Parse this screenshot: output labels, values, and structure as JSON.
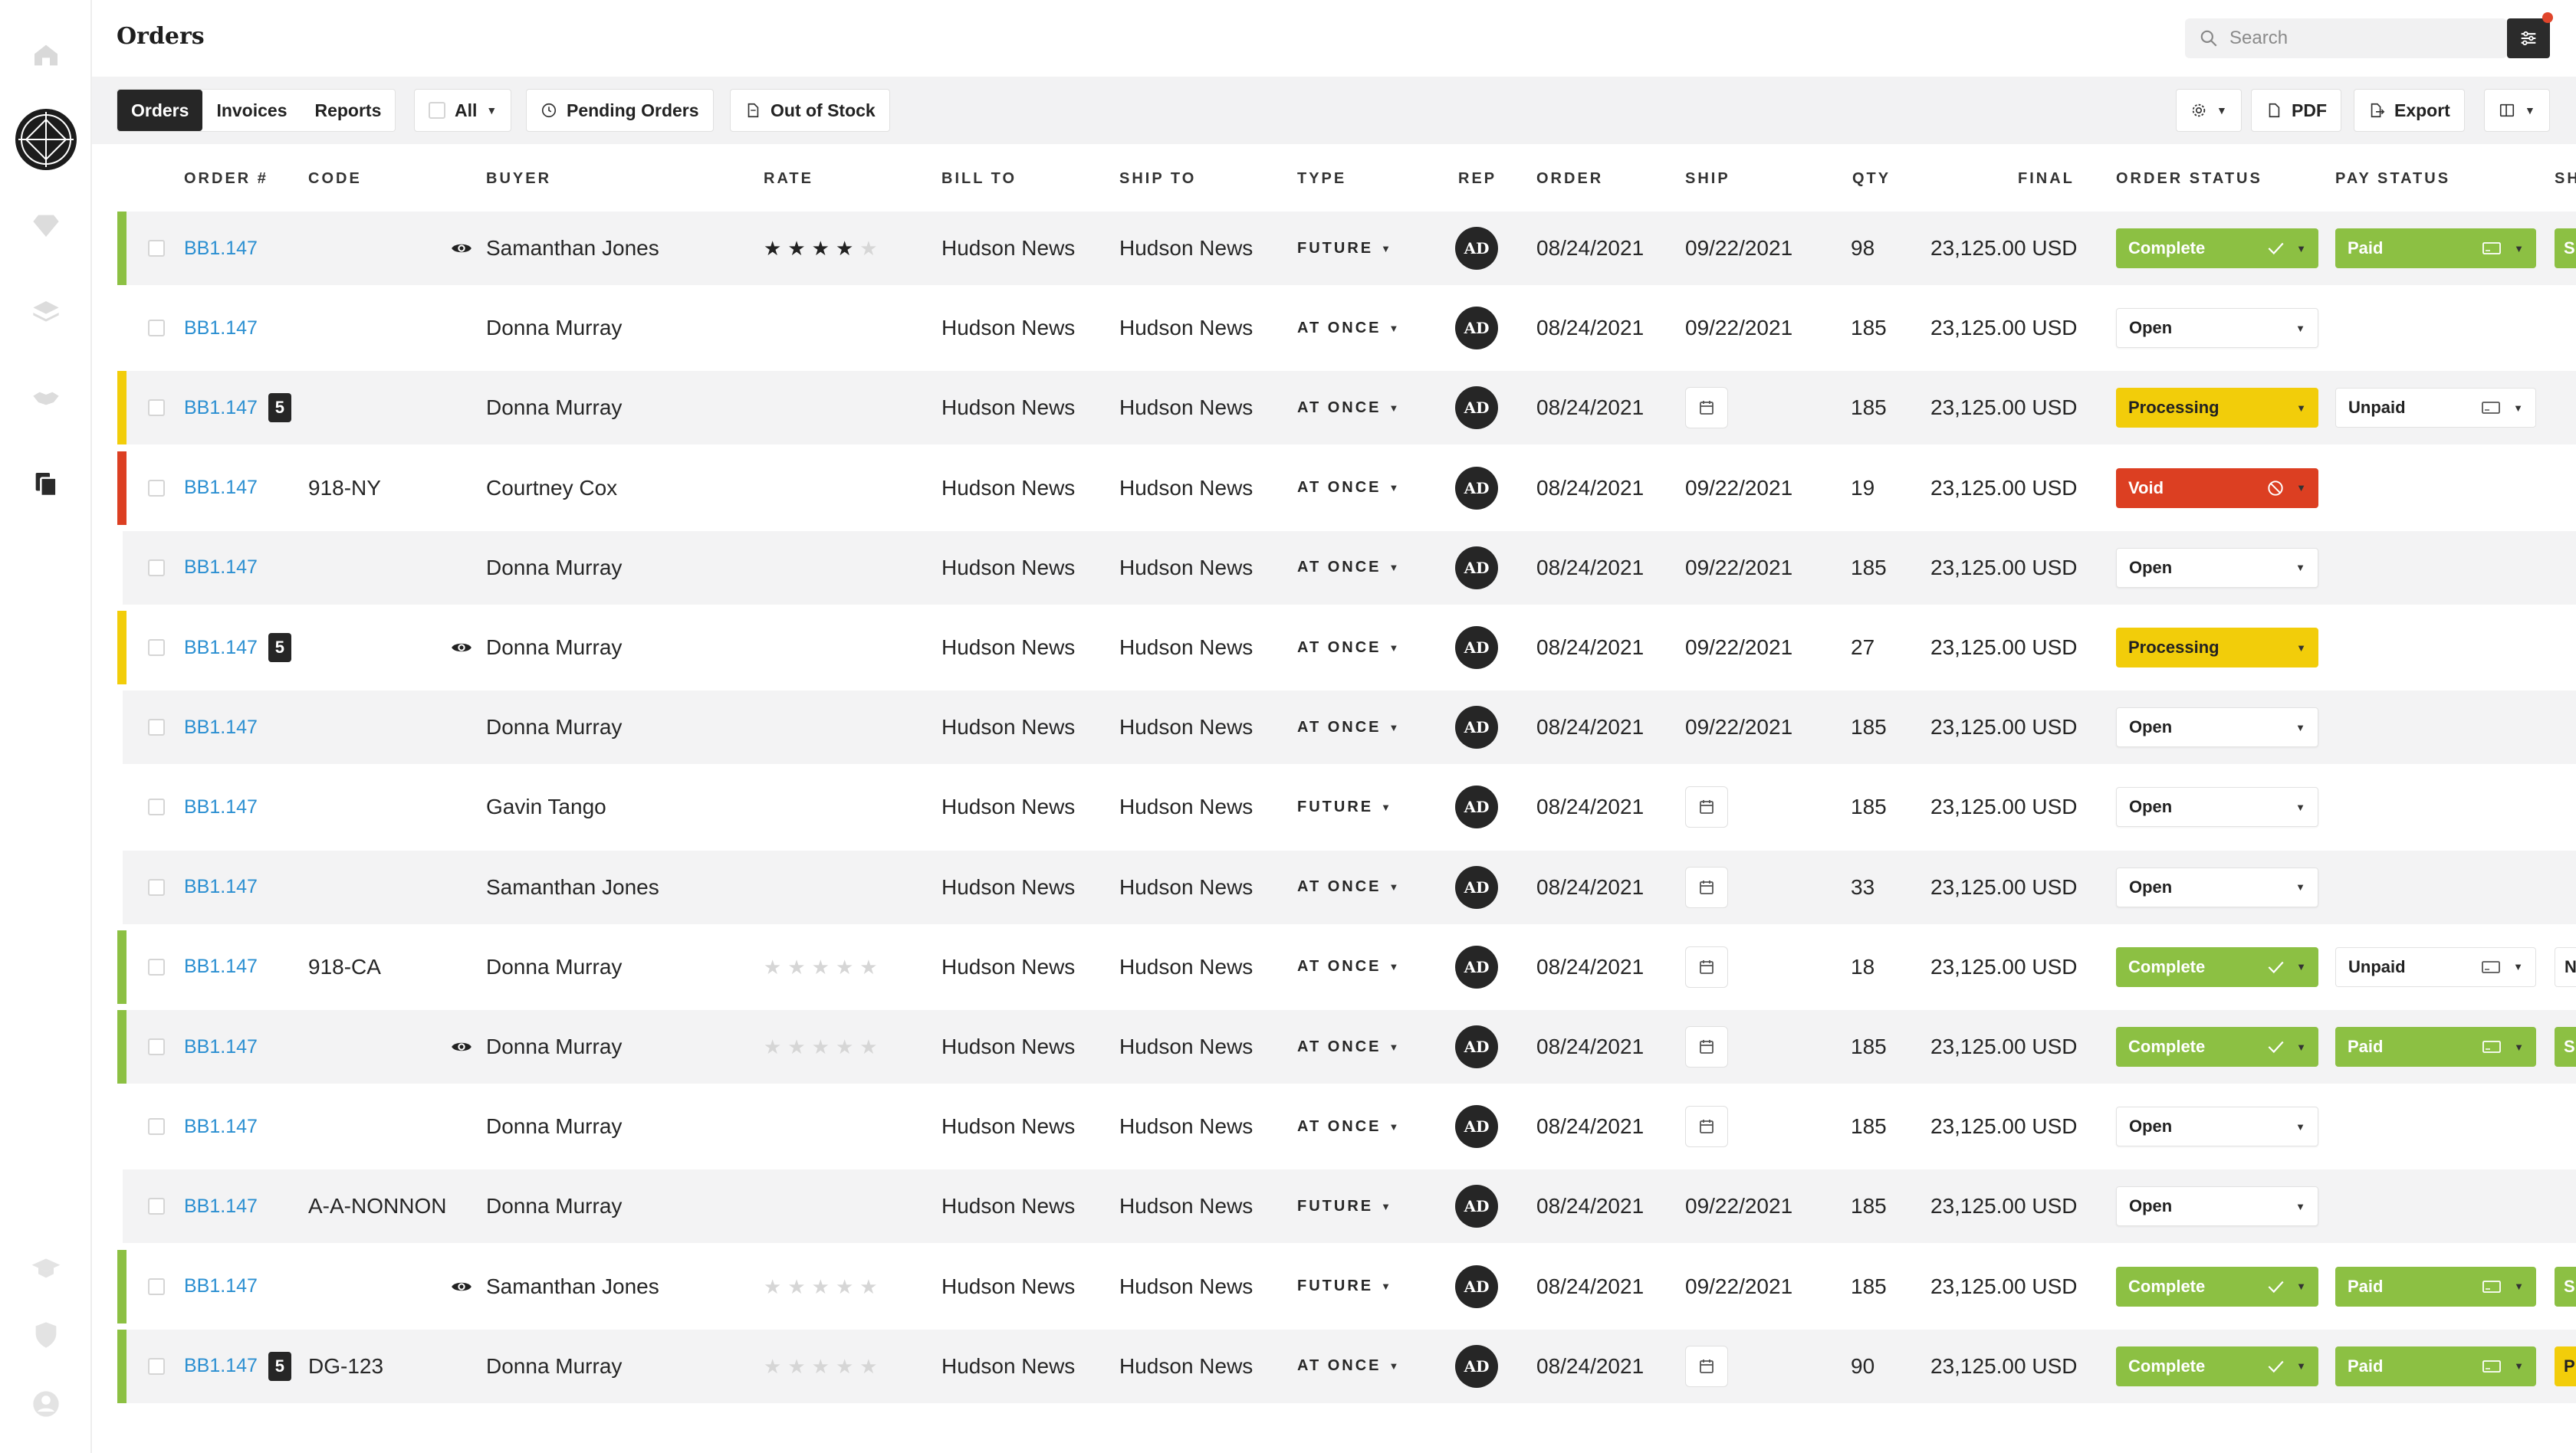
{
  "header": {
    "title": "Orders",
    "search_placeholder": "Search"
  },
  "toolbar": {
    "tabs": [
      "Orders",
      "Invoices",
      "Reports"
    ],
    "filter_all": "All",
    "pending": "Pending Orders",
    "out_of_stock": "Out of Stock",
    "pdf": "PDF",
    "export": "Export"
  },
  "columns": [
    "ORDER #",
    "CODE",
    "BUYER",
    "RATE",
    "BILL TO",
    "SHIP TO",
    "TYPE",
    "REP",
    "ORDER",
    "SHIP",
    "QTY",
    "FINAL",
    "ORDER STATUS",
    "PAY STATUS",
    "SH"
  ],
  "colors": {
    "complete": "#8cc043",
    "processing": "#f2cd0a",
    "void": "#dc3f22",
    "link": "#2b8fd1"
  },
  "rows": [
    {
      "order": "BB1.147",
      "badge": "",
      "code": "",
      "eye": true,
      "buyer": "Samanthan Jones",
      "rating": 4,
      "bill_to": "Hudson News",
      "ship_to": "Hudson News",
      "type": "FUTURE",
      "rep": "AD",
      "order_date": "08/24/2021",
      "ship": "09/22/2021",
      "qty": "98",
      "final": "23,125.00 USD",
      "order_status": "Complete",
      "pay_status": "Paid",
      "sh": "S",
      "bar": "complete"
    },
    {
      "order": "BB1.147",
      "badge": "",
      "code": "",
      "eye": false,
      "buyer": "Donna Murray",
      "rating": null,
      "bill_to": "Hudson News",
      "ship_to": "Hudson News",
      "type": "AT ONCE",
      "rep": "AD",
      "order_date": "08/24/2021",
      "ship": "09/22/2021",
      "qty": "185",
      "final": "23,125.00 USD",
      "order_status": "Open",
      "pay_status": "",
      "sh": "",
      "bar": ""
    },
    {
      "order": "BB1.147",
      "badge": "5",
      "code": "",
      "eye": false,
      "buyer": "Donna Murray",
      "rating": null,
      "bill_to": "Hudson News",
      "ship_to": "Hudson News",
      "type": "AT ONCE",
      "rep": "AD",
      "order_date": "08/24/2021",
      "ship": "",
      "qty": "185",
      "final": "23,125.00 USD",
      "order_status": "Processing",
      "pay_status": "Unpaid",
      "sh": "",
      "bar": "processing"
    },
    {
      "order": "BB1.147",
      "badge": "",
      "code": "918-NY",
      "eye": false,
      "buyer": "Courtney Cox",
      "rating": null,
      "bill_to": "Hudson News",
      "ship_to": "Hudson News",
      "type": "AT ONCE",
      "rep": "AD",
      "order_date": "08/24/2021",
      "ship": "09/22/2021",
      "qty": "19",
      "final": "23,125.00 USD",
      "order_status": "Void",
      "pay_status": "",
      "sh": "",
      "bar": "void"
    },
    {
      "order": "BB1.147",
      "badge": "",
      "code": "",
      "eye": false,
      "buyer": "Donna Murray",
      "rating": null,
      "bill_to": "Hudson News",
      "ship_to": "Hudson News",
      "type": "AT ONCE",
      "rep": "AD",
      "order_date": "08/24/2021",
      "ship": "09/22/2021",
      "qty": "185",
      "final": "23,125.00 USD",
      "order_status": "Open",
      "pay_status": "",
      "sh": "",
      "bar": ""
    },
    {
      "order": "BB1.147",
      "badge": "5",
      "code": "",
      "eye": true,
      "buyer": "Donna Murray",
      "rating": null,
      "bill_to": "Hudson News",
      "ship_to": "Hudson News",
      "type": "AT ONCE",
      "rep": "AD",
      "order_date": "08/24/2021",
      "ship": "09/22/2021",
      "qty": "27",
      "final": "23,125.00 USD",
      "order_status": "Processing",
      "pay_status": "",
      "sh": "",
      "bar": "processing"
    },
    {
      "order": "BB1.147",
      "badge": "",
      "code": "",
      "eye": false,
      "buyer": "Donna Murray",
      "rating": null,
      "bill_to": "Hudson News",
      "ship_to": "Hudson News",
      "type": "AT ONCE",
      "rep": "AD",
      "order_date": "08/24/2021",
      "ship": "09/22/2021",
      "qty": "185",
      "final": "23,125.00 USD",
      "order_status": "Open",
      "pay_status": "",
      "sh": "",
      "bar": ""
    },
    {
      "order": "BB1.147",
      "badge": "",
      "code": "",
      "eye": false,
      "buyer": "Gavin Tango",
      "rating": null,
      "bill_to": "Hudson News",
      "ship_to": "Hudson News",
      "type": "FUTURE",
      "rep": "AD",
      "order_date": "08/24/2021",
      "ship": "",
      "qty": "185",
      "final": "23,125.00 USD",
      "order_status": "Open",
      "pay_status": "",
      "sh": "",
      "bar": ""
    },
    {
      "order": "BB1.147",
      "badge": "",
      "code": "",
      "eye": false,
      "buyer": "Samanthan Jones",
      "rating": null,
      "bill_to": "Hudson News",
      "ship_to": "Hudson News",
      "type": "AT ONCE",
      "rep": "AD",
      "order_date": "08/24/2021",
      "ship": "",
      "qty": "33",
      "final": "23,125.00 USD",
      "order_status": "Open",
      "pay_status": "",
      "sh": "",
      "bar": ""
    },
    {
      "order": "BB1.147",
      "badge": "",
      "code": "918-CA",
      "eye": false,
      "buyer": "Donna Murray",
      "rating": 0,
      "bill_to": "Hudson News",
      "ship_to": "Hudson News",
      "type": "AT ONCE",
      "rep": "AD",
      "order_date": "08/24/2021",
      "ship": "",
      "qty": "18",
      "final": "23,125.00 USD",
      "order_status": "Complete",
      "pay_status": "Unpaid",
      "sh": "N",
      "bar": "complete"
    },
    {
      "order": "BB1.147",
      "badge": "",
      "code": "",
      "eye": true,
      "buyer": "Donna Murray",
      "rating": 0,
      "bill_to": "Hudson News",
      "ship_to": "Hudson News",
      "type": "AT ONCE",
      "rep": "AD",
      "order_date": "08/24/2021",
      "ship": "",
      "qty": "185",
      "final": "23,125.00 USD",
      "order_status": "Complete",
      "pay_status": "Paid",
      "sh": "S",
      "bar": "complete"
    },
    {
      "order": "BB1.147",
      "badge": "",
      "code": "",
      "eye": false,
      "buyer": "Donna Murray",
      "rating": null,
      "bill_to": "Hudson News",
      "ship_to": "Hudson News",
      "type": "AT ONCE",
      "rep": "AD",
      "order_date": "08/24/2021",
      "ship": "",
      "qty": "185",
      "final": "23,125.00 USD",
      "order_status": "Open",
      "pay_status": "",
      "sh": "",
      "bar": ""
    },
    {
      "order": "BB1.147",
      "badge": "",
      "code": "A-A-NONNON",
      "eye": false,
      "buyer": "Donna Murray",
      "rating": null,
      "bill_to": "Hudson News",
      "ship_to": "Hudson News",
      "type": "FUTURE",
      "rep": "AD",
      "order_date": "08/24/2021",
      "ship": "09/22/2021",
      "qty": "185",
      "final": "23,125.00 USD",
      "order_status": "Open",
      "pay_status": "",
      "sh": "",
      "bar": ""
    },
    {
      "order": "BB1.147",
      "badge": "",
      "code": "",
      "eye": true,
      "buyer": "Samanthan Jones",
      "rating": 0,
      "bill_to": "Hudson News",
      "ship_to": "Hudson News",
      "type": "FUTURE",
      "rep": "AD",
      "order_date": "08/24/2021",
      "ship": "09/22/2021",
      "qty": "185",
      "final": "23,125.00 USD",
      "order_status": "Complete",
      "pay_status": "Paid",
      "sh": "S",
      "bar": "complete"
    },
    {
      "order": "BB1.147",
      "badge": "5",
      "code": "DG-123",
      "eye": false,
      "buyer": "Donna Murray",
      "rating": 0,
      "bill_to": "Hudson News",
      "ship_to": "Hudson News",
      "type": "AT ONCE",
      "rep": "AD",
      "order_date": "08/24/2021",
      "ship": "",
      "qty": "90",
      "final": "23,125.00 USD",
      "order_status": "Complete",
      "pay_status": "Paid",
      "sh": "P",
      "bar": "complete"
    }
  ]
}
